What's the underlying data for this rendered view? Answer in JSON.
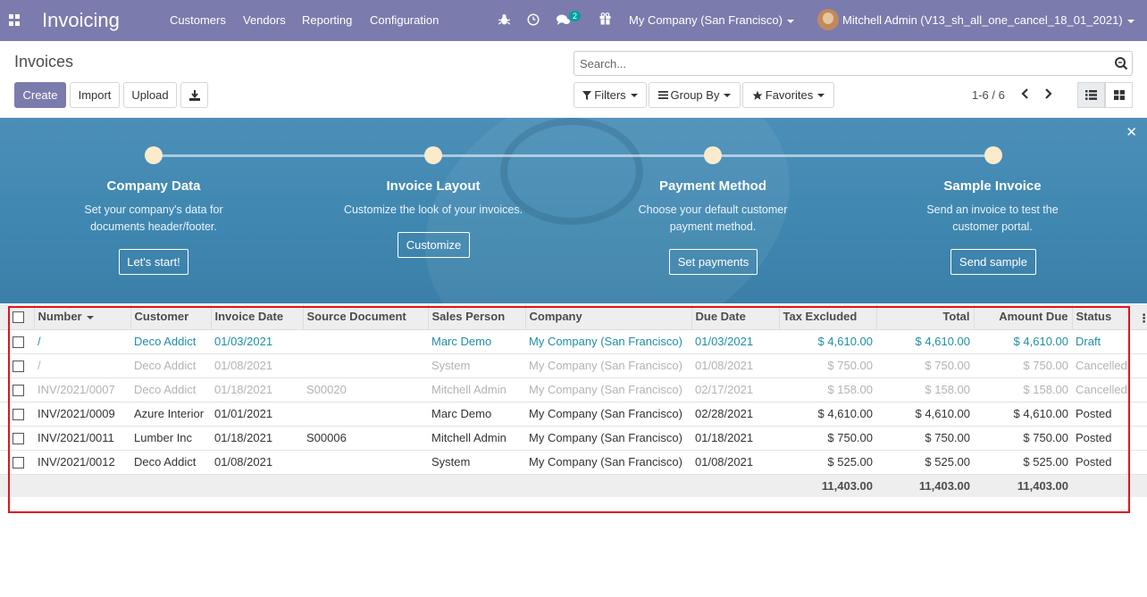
{
  "navbar": {
    "app_title": "Invoicing",
    "menus": [
      "Customers",
      "Vendors",
      "Reporting",
      "Configuration"
    ],
    "message_count": "2",
    "company": "My Company (San Francisco)",
    "user": "Mitchell Admin (V13_sh_all_one_cancel_18_01_2021)",
    "bg_color": "#7c7bad"
  },
  "control_panel": {
    "breadcrumb": "Invoices",
    "search_placeholder": "Search...",
    "buttons": {
      "create": "Create",
      "import": "Import",
      "upload": "Upload"
    },
    "filters": "Filters",
    "group_by": "Group By",
    "favorites": "Favorites",
    "pager": "1-6 / 6"
  },
  "banner": {
    "steps": [
      {
        "title": "Company Data",
        "desc1": "Set your company's data for",
        "desc2": "documents header/footer.",
        "button": "Let's start!"
      },
      {
        "title": "Invoice Layout",
        "desc1": "Customize the look of your invoices.",
        "desc2": "",
        "button": "Customize"
      },
      {
        "title": "Payment Method",
        "desc1": "Choose your default customer",
        "desc2": "payment method.",
        "button": "Set payments"
      },
      {
        "title": "Sample Invoice",
        "desc1": "Send an invoice to test the",
        "desc2": "customer portal.",
        "button": "Send sample"
      }
    ]
  },
  "table": {
    "columns": [
      "Number",
      "Customer",
      "Invoice Date",
      "Source Document",
      "Sales Person",
      "Company",
      "Due Date",
      "Tax Excluded",
      "Total",
      "Amount Due",
      "Status"
    ],
    "rows": [
      {
        "number": "/",
        "customer": "Deco Addict",
        "invoice_date": "01/03/2021",
        "source": "",
        "sales_person": "Marc Demo",
        "company": "My Company (San Francisco)",
        "due_date": "01/03/2021",
        "tax_excluded": "$ 4,610.00",
        "total": "$ 4,610.00",
        "amount_due": "$ 4,610.00",
        "status": "Draft"
      },
      {
        "number": "/",
        "customer": "Deco Addict",
        "invoice_date": "01/08/2021",
        "source": "",
        "sales_person": "System",
        "company": "My Company (San Francisco)",
        "due_date": "01/08/2021",
        "tax_excluded": "$ 750.00",
        "total": "$ 750.00",
        "amount_due": "$ 750.00",
        "status": "Cancelled"
      },
      {
        "number": "INV/2021/0007",
        "customer": "Deco Addict",
        "invoice_date": "01/18/2021",
        "source": "S00020",
        "sales_person": "Mitchell Admin",
        "company": "My Company (San Francisco)",
        "due_date": "02/17/2021",
        "tax_excluded": "$ 158.00",
        "total": "$ 158.00",
        "amount_due": "$ 158.00",
        "status": "Cancelled"
      },
      {
        "number": "INV/2021/0009",
        "customer": "Azure Interior",
        "invoice_date": "01/01/2021",
        "source": "",
        "sales_person": "Marc Demo",
        "company": "My Company (San Francisco)",
        "due_date": "02/28/2021",
        "tax_excluded": "$ 4,610.00",
        "total": "$ 4,610.00",
        "amount_due": "$ 4,610.00",
        "status": "Posted"
      },
      {
        "number": "INV/2021/0011",
        "customer": "Lumber Inc",
        "invoice_date": "01/18/2021",
        "source": "S00006",
        "sales_person": "Mitchell Admin",
        "company": "My Company (San Francisco)",
        "due_date": "01/18/2021",
        "tax_excluded": "$ 750.00",
        "total": "$ 750.00",
        "amount_due": "$ 750.00",
        "status": "Posted"
      },
      {
        "number": "INV/2021/0012",
        "customer": "Deco Addict",
        "invoice_date": "01/08/2021",
        "source": "",
        "sales_person": "System",
        "company": "My Company (San Francisco)",
        "due_date": "01/08/2021",
        "tax_excluded": "$ 525.00",
        "total": "$ 525.00",
        "amount_due": "$ 525.00",
        "status": "Posted"
      }
    ],
    "totals": {
      "tax_excluded": "11,403.00",
      "total": "11,403.00",
      "amount_due": "11,403.00"
    }
  }
}
